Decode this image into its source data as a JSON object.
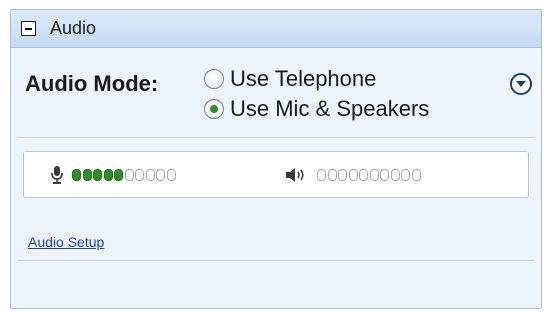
{
  "panel": {
    "title": "Audio",
    "collapse_icon": "minus-box-icon"
  },
  "audio_mode": {
    "label": "Audio Mode:",
    "options": [
      {
        "label": "Use Telephone",
        "selected": false
      },
      {
        "label": "Use Mic & Speakers",
        "selected": true
      }
    ],
    "menu_icon": "chevron-down-circle-icon"
  },
  "levels": {
    "mic": {
      "icon": "microphone-icon",
      "segments_total": 10,
      "segments_lit": 5
    },
    "speaker": {
      "icon": "speaker-icon",
      "segments_total": 10,
      "segments_lit": 0
    }
  },
  "setup_link": "Audio Setup",
  "colors": {
    "panel_bg": "#eef4fc",
    "header_bg": "#c6daf3",
    "level_on": "#2e8f25",
    "level_off": "#a3a8ae",
    "radio_selected": "#2f8a2c",
    "link": "#1d3fb5"
  }
}
